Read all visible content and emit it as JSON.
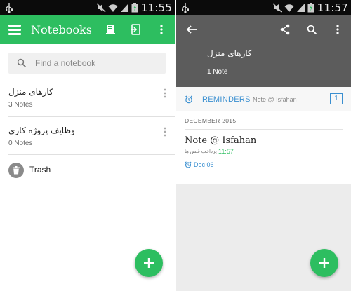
{
  "left": {
    "status": {
      "time": "11:55"
    },
    "app_title": "Notebooks",
    "search_placeholder": "Find a notebook",
    "notebooks": [
      {
        "name": "کارهای منزل",
        "count": "3 Notes"
      },
      {
        "name": "وظایف پروژه کاری",
        "count": "0 Notes"
      }
    ],
    "trash_label": "Trash"
  },
  "right": {
    "status": {
      "time": "11:57"
    },
    "notebook_title": "کارهای منزل",
    "notebook_count": "1 Note",
    "reminders": {
      "label": "REMINDERS",
      "note": "Note @ Isfahan",
      "count": "1"
    },
    "month": "DECEMBER 2015",
    "note": {
      "title": "Note @ Isfahan",
      "snippet": "پرداخت قبض ها",
      "time": "11:57",
      "reminder_date": "Dec 06"
    }
  },
  "colors": {
    "brand_green": "#2dbe60",
    "header_grey": "#5c5c5c",
    "reminder_blue": "#3a8fd0",
    "status_bar": "#0b0b0b"
  },
  "icons": [
    "usb-icon",
    "mute-icon",
    "wifi-icon",
    "signal-icon",
    "battery-icon",
    "menu-icon",
    "notebook-icon",
    "move-icon",
    "more-vert-icon",
    "search-icon",
    "trash-icon",
    "plus-icon",
    "back-arrow-icon",
    "share-icon",
    "alarm-clock-icon"
  ]
}
